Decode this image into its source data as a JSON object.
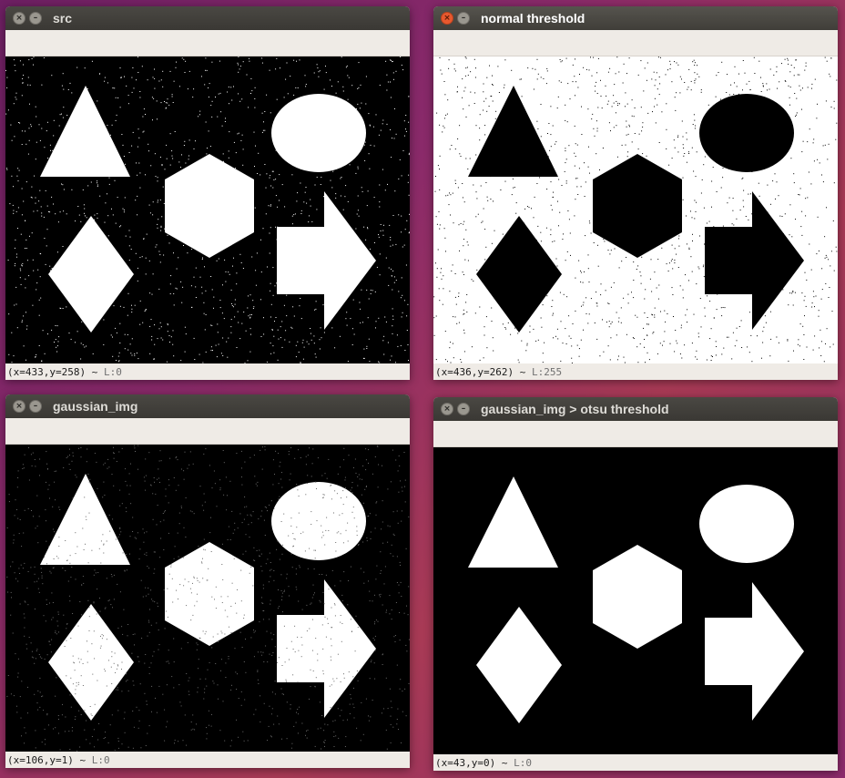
{
  "windows": [
    {
      "id": "src",
      "title": "src",
      "status_coords": "(x=433,y=258)",
      "status_sep": "~",
      "status_value": "L:0",
      "colors": {
        "background": "#000000",
        "shapes": "#ffffff",
        "noise": "#ffffff"
      }
    },
    {
      "id": "normal-threshold",
      "title": "normal threshold",
      "status_coords": "(x=436,y=262)",
      "status_sep": "~",
      "status_value": "L:255",
      "colors": {
        "background": "#ffffff",
        "shapes": "#000000",
        "noise": "#000000"
      }
    },
    {
      "id": "gaussian-img",
      "title": "gaussian_img",
      "status_coords": "(x=106,y=1)",
      "status_sep": "~",
      "status_value": "L:0",
      "colors": {
        "background": "#000000",
        "shapes": "#ffffff",
        "noise": "#6a6a6a"
      }
    },
    {
      "id": "gaussian-otsu",
      "title": "gaussian_img > otsu threshold",
      "status_coords": "(x=43,y=0)",
      "status_sep": "~",
      "status_value": "L:0",
      "colors": {
        "background": "#000000",
        "shapes": "#ffffff",
        "noise": "none"
      }
    }
  ],
  "icons": {
    "close": "close-icon",
    "minimize": "minimize-icon"
  },
  "glyphs": {
    "close": "×",
    "minimize": "–"
  }
}
